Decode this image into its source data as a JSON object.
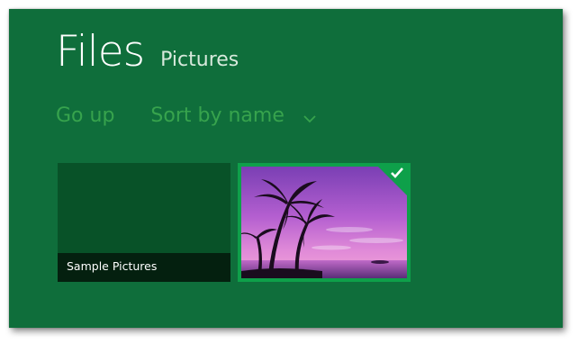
{
  "header": {
    "title": "Files",
    "subtitle": "Pictures"
  },
  "toolbar": {
    "go_up_label": "Go up",
    "sort_label": "Sort by name",
    "sort_icon": "chevron-down-icon"
  },
  "tiles": [
    {
      "label": "Sample Pictures",
      "type": "folder",
      "selected": false
    },
    {
      "label": "",
      "type": "image",
      "selected": true,
      "selected_icon": "checkmark-icon"
    }
  ],
  "colors": {
    "background": "#0f6e3b",
    "accent": "#37a34d",
    "selection": "#0ea04a",
    "folder_tile": "#085228"
  }
}
